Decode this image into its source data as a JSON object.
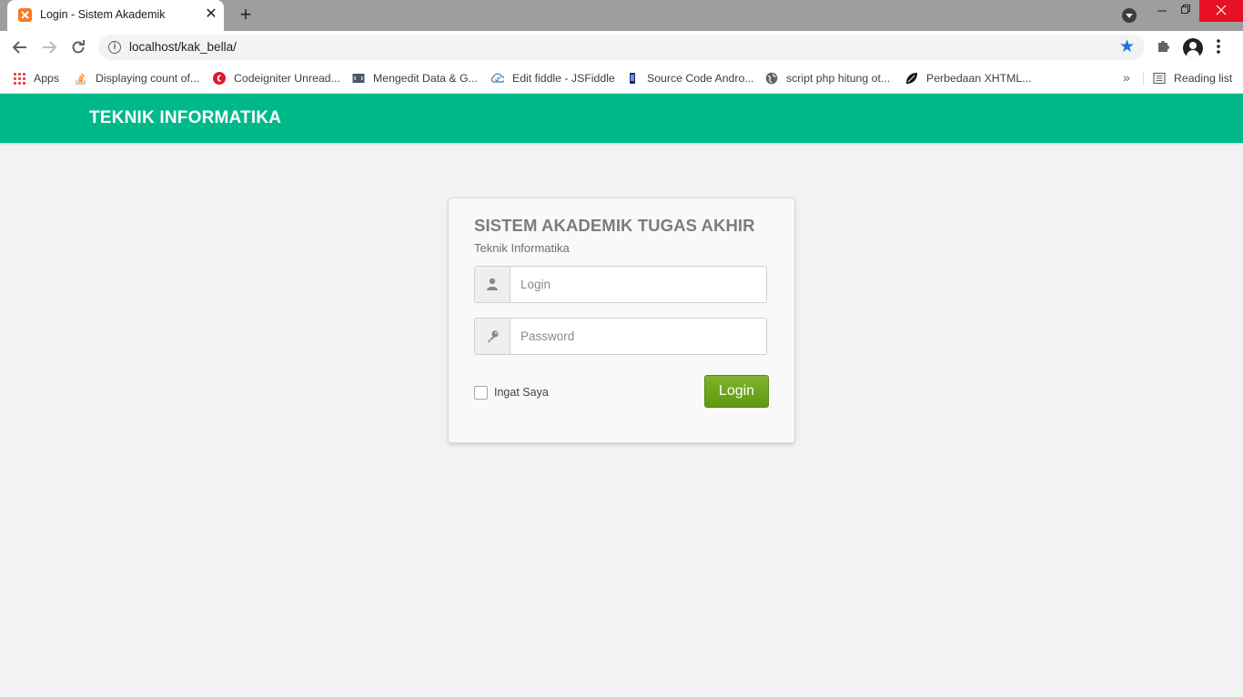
{
  "browser": {
    "tab_title": "Login - Sistem Akademik",
    "tab_close": "✕",
    "new_tab": "+",
    "url": "localhost/kak_bella/",
    "bookmarks": [
      {
        "label": "Apps",
        "icon": "apps-grid-icon"
      },
      {
        "label": "Displaying count of...",
        "icon": "stackoverflow-icon"
      },
      {
        "label": "Codeigniter Unread...",
        "icon": "codeigniter-icon"
      },
      {
        "label": "Mengedit Data & G...",
        "icon": "code-page-icon"
      },
      {
        "label": "Edit fiddle - JSFiddle",
        "icon": "jsfiddle-icon"
      },
      {
        "label": "Source Code Andro...",
        "icon": "phone-icon"
      },
      {
        "label": "script php hitung ot...",
        "icon": "globe-icon"
      },
      {
        "label": "Perbedaan XHTML...",
        "icon": "leaf-icon"
      }
    ],
    "more_bookmarks": "»",
    "reading_list": "Reading list"
  },
  "page": {
    "brand": "TEKNIK INFORMATIKA",
    "card": {
      "title": "SISTEM AKADEMIK TUGAS AKHIR",
      "subtitle": "Teknik Informatika",
      "login_placeholder": "Login",
      "password_placeholder": "Password",
      "remember_label": "Ingat Saya",
      "remember_checked": false,
      "submit_label": "Login"
    }
  },
  "colors": {
    "header": "#00b98b",
    "button": "#6aa51b",
    "accent_star": "#1a73e8"
  }
}
